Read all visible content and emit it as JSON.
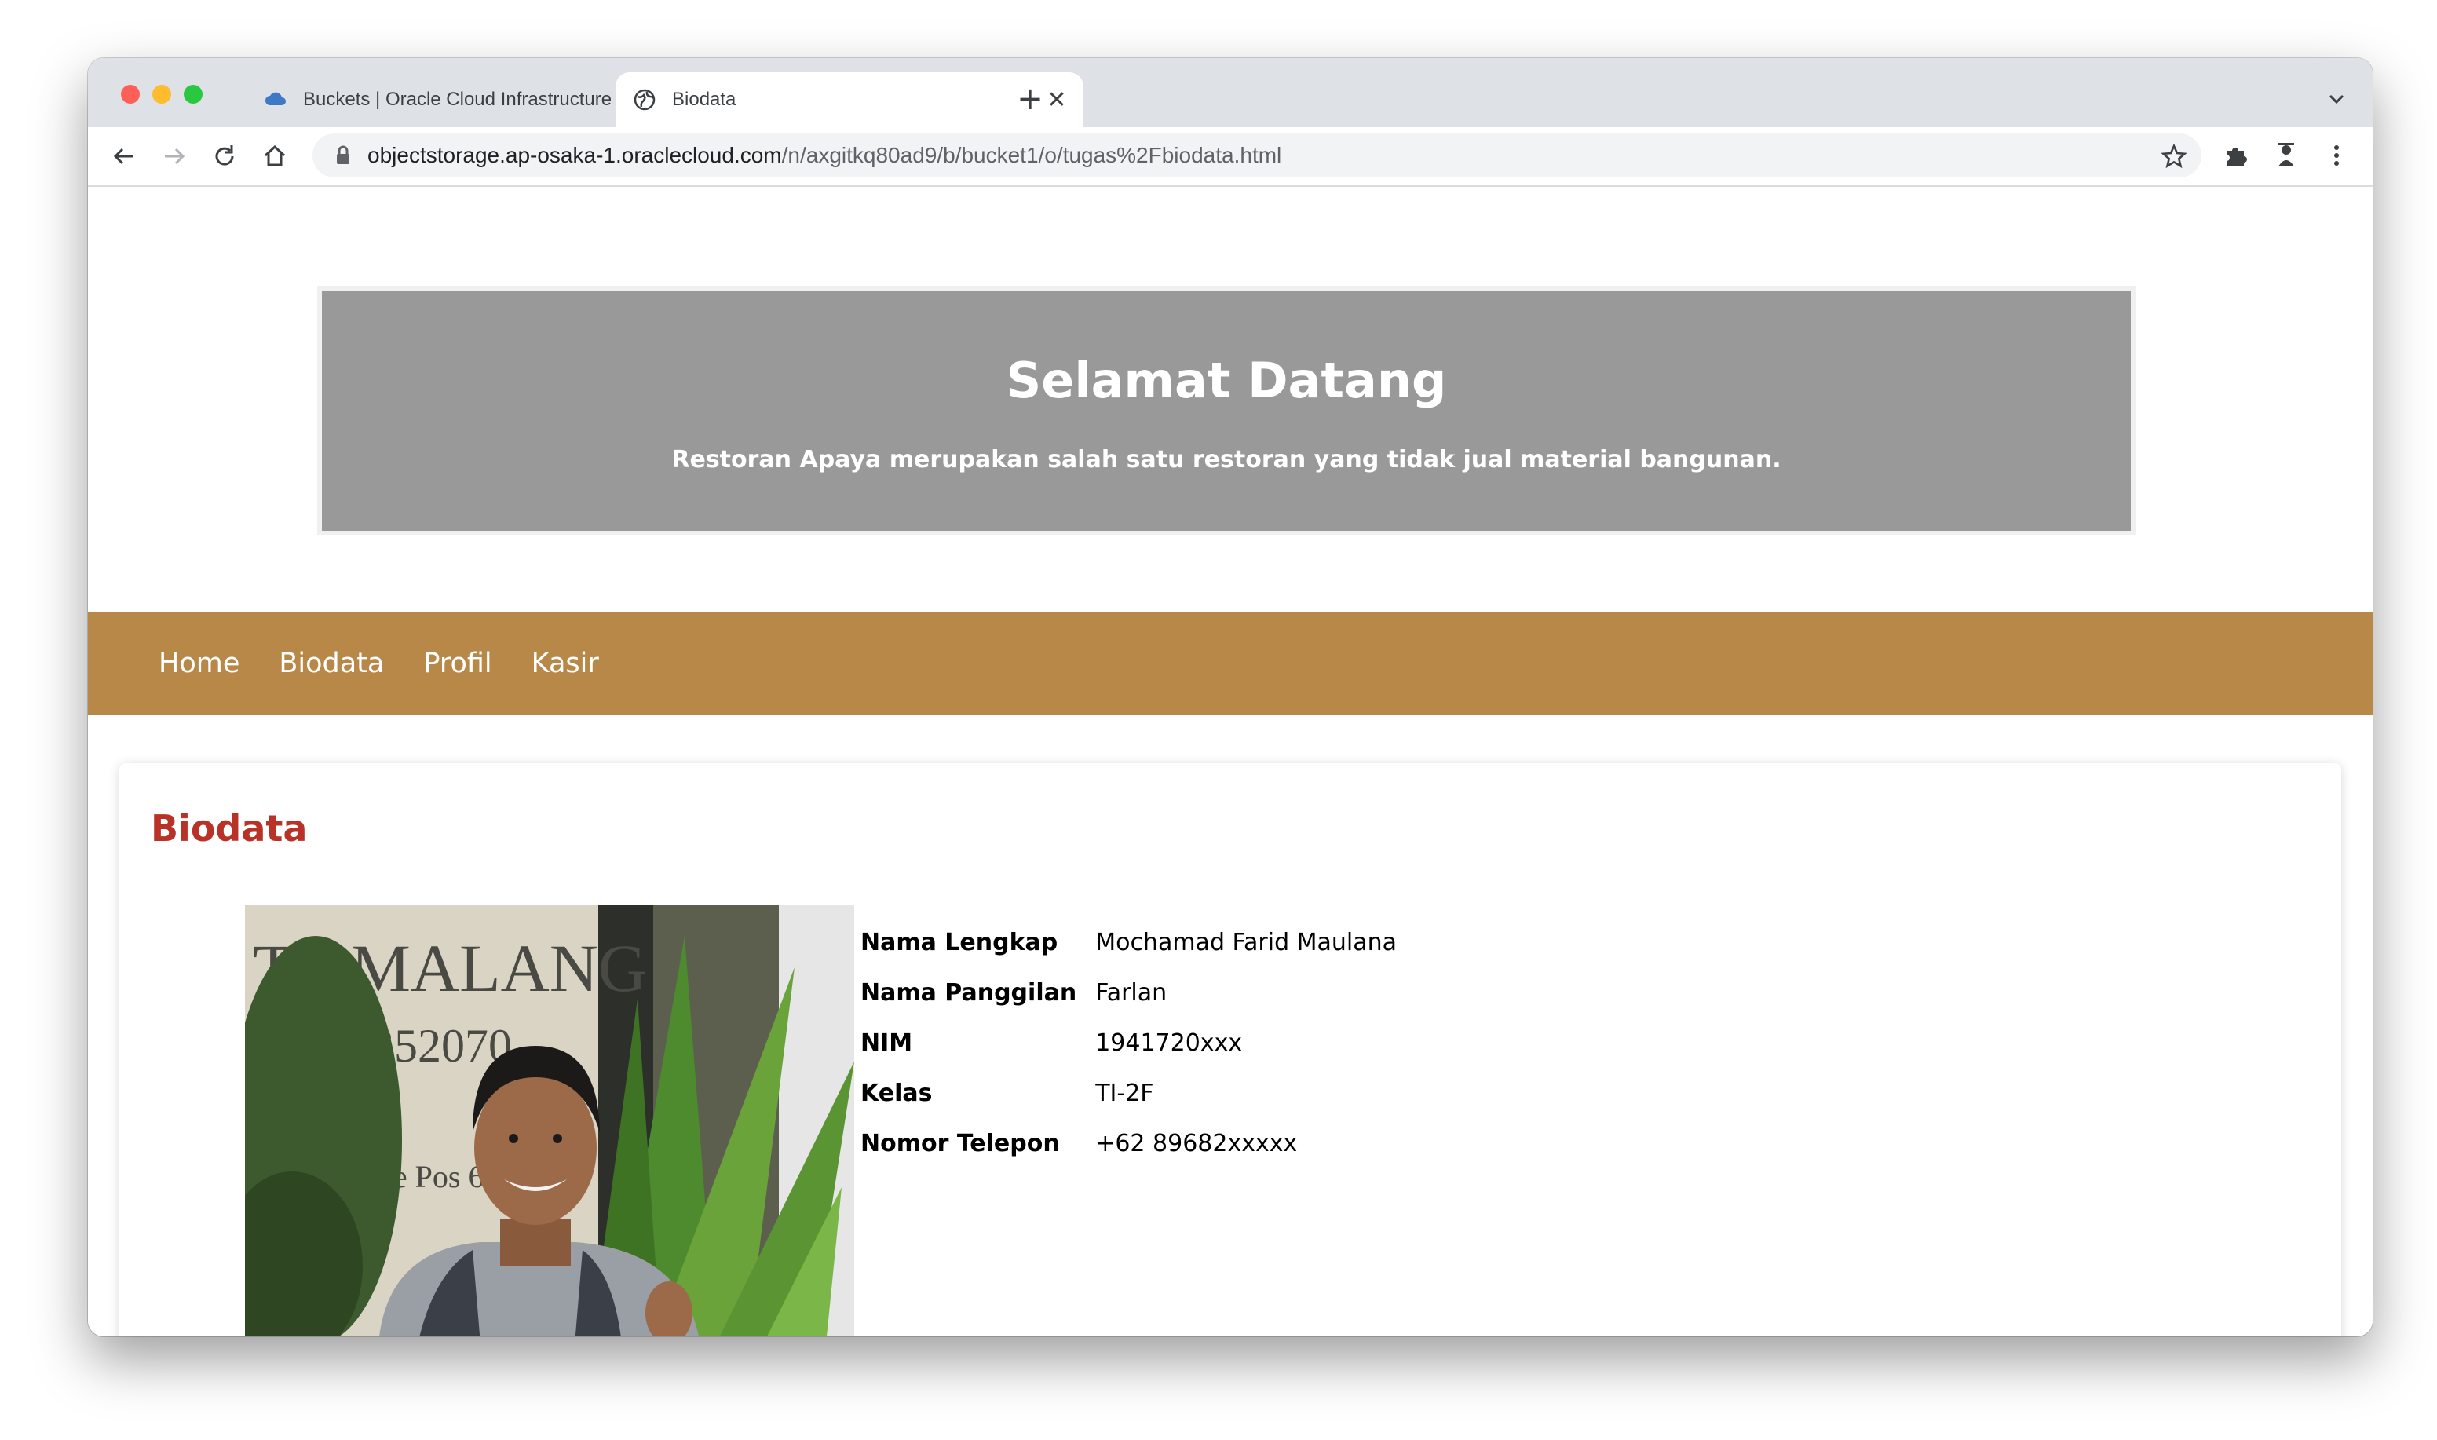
{
  "browser": {
    "tabs": [
      {
        "title": "Buckets | Oracle Cloud Infrastructure",
        "favicon": "cloud-icon",
        "active": false
      },
      {
        "title": "Biodata",
        "favicon": "globe-icon",
        "active": true
      }
    ],
    "close_glyph": "✕",
    "new_tab_glyph": "+",
    "url_host": "objectstorage.ap-osaka-1.oraclecloud.com",
    "url_path": "/n/axgitkq80ad9/b/bucket1/o/tugas%2Fbiodata.html"
  },
  "hero": {
    "title": "Selamat Datang",
    "subtitle": "Restoran Apaya merupakan salah satu restoran yang tidak jual material bangunan."
  },
  "nav": {
    "items": [
      {
        "label": "Home"
      },
      {
        "label": "Biodata"
      },
      {
        "label": "Profil"
      },
      {
        "label": "Kasir"
      }
    ]
  },
  "biodata": {
    "heading": "Biodata",
    "rows": [
      {
        "label": "Nama Lengkap",
        "value": "Mochamad Farid Maulana"
      },
      {
        "label": "Nama Panggilan",
        "value": "Farlan"
      },
      {
        "label": "NIM",
        "value": "1941720xxx"
      },
      {
        "label": "Kelas",
        "value": "TI-2F"
      },
      {
        "label": "Nomor Telepon",
        "value": "+62 89682xxxxx"
      }
    ],
    "photo_sign_text": "TA MALANG",
    "photo_sign_code": "352070",
    "photo_sign_postal": "Kode Pos 65119"
  },
  "colors": {
    "hero_bg": "#999999",
    "nav_bg": "#b88848",
    "heading": "#b83228"
  }
}
